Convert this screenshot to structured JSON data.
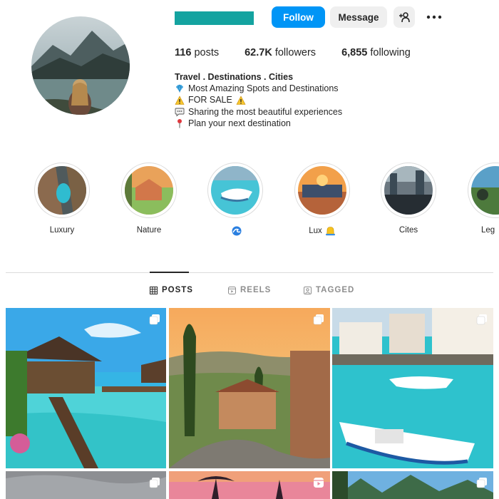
{
  "profile": {
    "actions": {
      "follow": "Follow",
      "message": "Message"
    },
    "stats": [
      {
        "value": "116",
        "label": "posts"
      },
      {
        "value": "62.7K",
        "label": "followers"
      },
      {
        "value": "6,855",
        "label": "following"
      }
    ],
    "bio": {
      "name": "Travel . Destinations . Cities",
      "lines": [
        {
          "icon": "diamond-icon",
          "text": "Most Amazing Spots and Destinations"
        },
        {
          "icon": "warning-icon",
          "text": "FOR SALE",
          "trailing_icon": "warning-icon"
        },
        {
          "icon": "speech-bubble-icon",
          "text": "Sharing the most beautiful experiences"
        },
        {
          "icon": "pushpin-icon",
          "text": "Plan your next destination"
        }
      ]
    }
  },
  "highlights": [
    {
      "label": "Luxury"
    },
    {
      "label": "Nature"
    },
    {
      "label": "",
      "icon": "wave-icon"
    },
    {
      "label": "Lux",
      "icon": "bell-icon"
    },
    {
      "label": "Cites"
    },
    {
      "label": "Leg"
    }
  ],
  "tabs": [
    {
      "label": "POSTS",
      "icon": "grid-icon",
      "active": true
    },
    {
      "label": "REELS",
      "icon": "reels-icon",
      "active": false
    },
    {
      "label": "TAGGED",
      "icon": "tagged-icon",
      "active": false
    }
  ],
  "posts": [
    {
      "scene": "overwater-bungalow",
      "badge": "multi-photo-icon"
    },
    {
      "scene": "tuscany-sunset-villa",
      "badge": "multi-photo-icon"
    },
    {
      "scene": "coastal-village-boat",
      "badge": "multi-photo-icon"
    },
    {
      "scene": "cloudy-sky",
      "badge": "multi-photo-icon"
    },
    {
      "scene": "palm-sunset",
      "badge": "reel-icon"
    },
    {
      "scene": "tropical-mountains",
      "badge": "multi-photo-icon"
    }
  ],
  "colors": {
    "accent": "#0095f6",
    "username_redaction": "#14a3a0"
  }
}
